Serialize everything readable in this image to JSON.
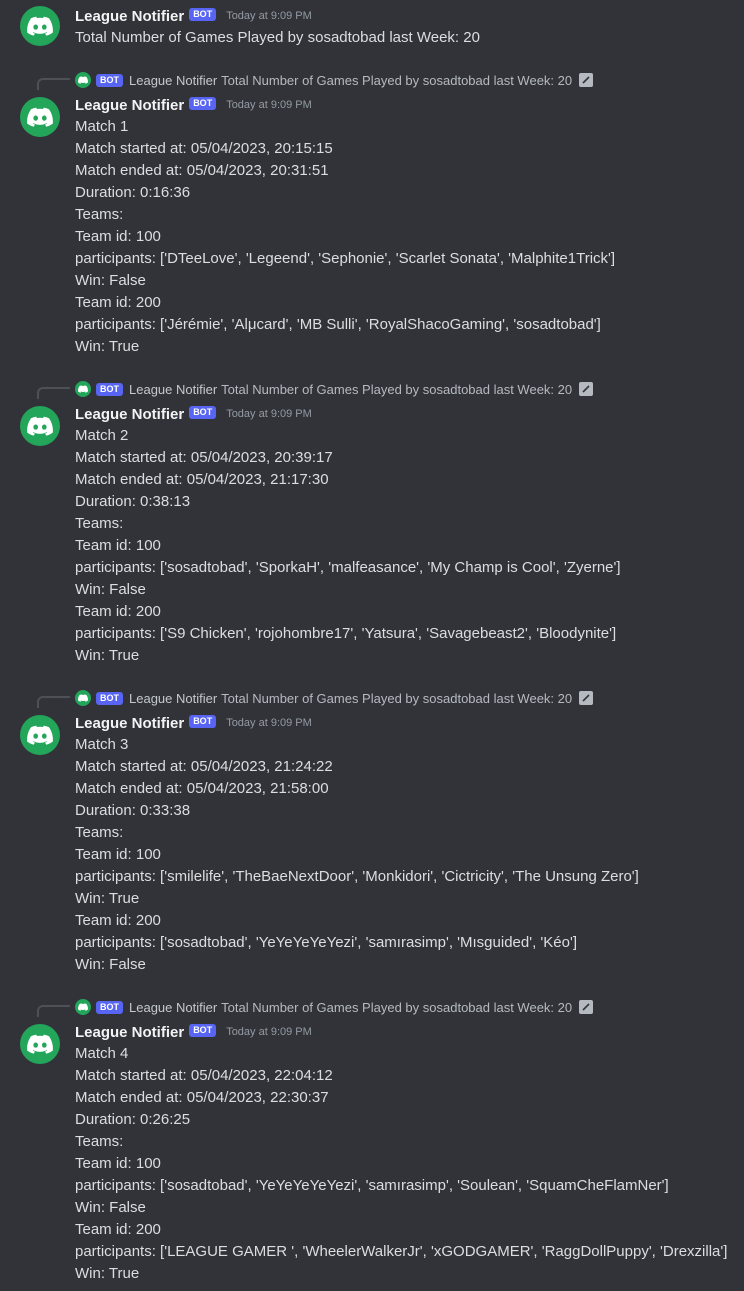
{
  "app": {
    "name": "League Notifier",
    "bot_tag": "BOT",
    "timestamp": "Today at 9:09 PM"
  },
  "first_message": {
    "username": "League Notifier",
    "tag": "BOT",
    "timestamp": "Today at 9:09 PM",
    "text": "Total Number of Games Played by sosadtobad last Week: 20"
  },
  "messages": [
    {
      "reply": {
        "tag": "BOT",
        "name": "League Notifier",
        "text": "Total Number of Games Played by sosadtobad last Week: 20",
        "icon": "image-icon"
      },
      "username": "League Notifier",
      "tag": "BOT",
      "timestamp": "Today at 9:09 PM",
      "lines": [
        "Match 1",
        "Match started at: 05/04/2023, 20:15:15",
        "Match ended at: 05/04/2023, 20:31:51",
        "Duration: 0:16:36",
        "Teams:",
        "Team id: 100",
        "participants: ['DTeeLove', 'Legeend', 'Sephonie', 'Scarlet Sonata', 'Malphite1Trick']",
        "Win: False",
        "Team id: 200",
        "participants: ['Jérémie', 'Alμcard', 'MB Sulli', 'RoyalShacoGaming', 'sosadtobad']",
        "Win: True"
      ]
    },
    {
      "reply": {
        "tag": "BOT",
        "name": "League Notifier",
        "text": "Total Number of Games Played by sosadtobad last Week: 20",
        "icon": "image-icon"
      },
      "username": "League Notifier",
      "tag": "BOT",
      "timestamp": "Today at 9:09 PM",
      "lines": [
        "Match 2",
        "Match started at: 05/04/2023, 20:39:17",
        "Match ended at: 05/04/2023, 21:17:30",
        "Duration: 0:38:13",
        "Teams:",
        "Team id: 100",
        "participants: ['sosadtobad', 'SporkaH', 'malfeasance', 'My Champ is Cool', 'Zyerne']",
        "Win: False",
        "Team id: 200",
        "participants: ['S9 Chicken', 'rojohombre17', 'Yatsura', 'Savagebeast2', 'Bloodynite']",
        "Win: True"
      ]
    },
    {
      "reply": {
        "tag": "BOT",
        "name": "League Notifier",
        "text": "Total Number of Games Played by sosadtobad last Week: 20",
        "icon": "image-icon"
      },
      "username": "League Notifier",
      "tag": "BOT",
      "timestamp": "Today at 9:09 PM",
      "lines": [
        "Match 3",
        "Match started at: 05/04/2023, 21:24:22",
        "Match ended at: 05/04/2023, 21:58:00",
        "Duration: 0:33:38",
        "Teams:",
        "Team id: 100",
        "participants: ['smilelife', 'TheBaeNextDoor', 'Monkidori', 'Cictricity', 'The Unsung Zero']",
        "Win: True",
        "Team id: 200",
        "participants: ['sosadtobad', 'YeYeYeYeYezi', 'samırasimp', 'Mısguided', 'Kéo']",
        "Win: False"
      ]
    },
    {
      "reply": {
        "tag": "BOT",
        "name": "League Notifier",
        "text": "Total Number of Games Played by sosadtobad last Week: 20",
        "icon": "image-icon"
      },
      "username": "League Notifier",
      "tag": "BOT",
      "timestamp": "Today at 9:09 PM",
      "lines": [
        "Match 4",
        "Match started at: 05/04/2023, 22:04:12",
        "Match ended at: 05/04/2023, 22:30:37",
        "Duration: 0:26:25",
        "Teams:",
        "Team id: 100",
        "participants: ['sosadtobad', 'YeYeYeYeYezi', 'samırasimp', 'Soulean', 'SquamCheFlamNer']",
        "Win: False",
        "Team id: 200",
        "participants: ['LEAGUE GAMER ', 'WheelerWalkerJr', 'xGODGAMER', 'RaggDollPuppy', 'Drexzilla']",
        "Win: True"
      ]
    }
  ],
  "colors": {
    "background": "#313338",
    "avatar": "#23a55a",
    "bot_tag": "#5865f2",
    "text": "#dbdee1",
    "username": "#f2f3f5",
    "timestamp": "#949ba4"
  },
  "icons": {
    "avatar": "discord-logo-icon",
    "reply_attachment": "image-icon"
  }
}
